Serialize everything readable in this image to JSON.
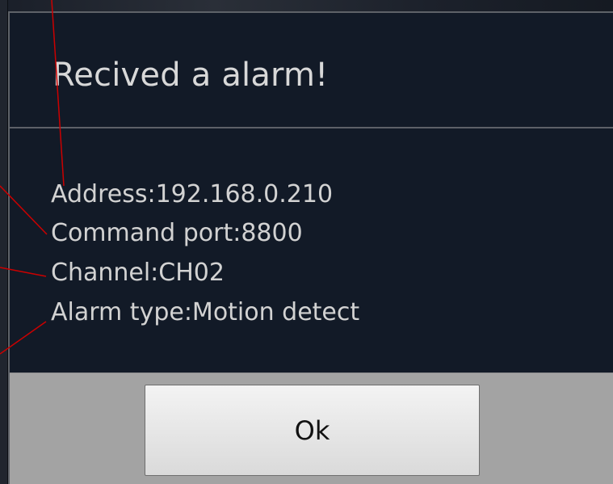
{
  "dialog": {
    "title": "Recived a alarm!",
    "message_lines": [
      "Address:192.168.0.210",
      "Command port:8800",
      "Channel:CH02",
      "Alarm type:Motion detect"
    ],
    "ok_label": "Ok"
  },
  "colors": {
    "dialog_background": "#121a27",
    "button_bar": "#a3a3a3",
    "annotation_lines": "#cc0000",
    "text": "#d2d2d2"
  }
}
